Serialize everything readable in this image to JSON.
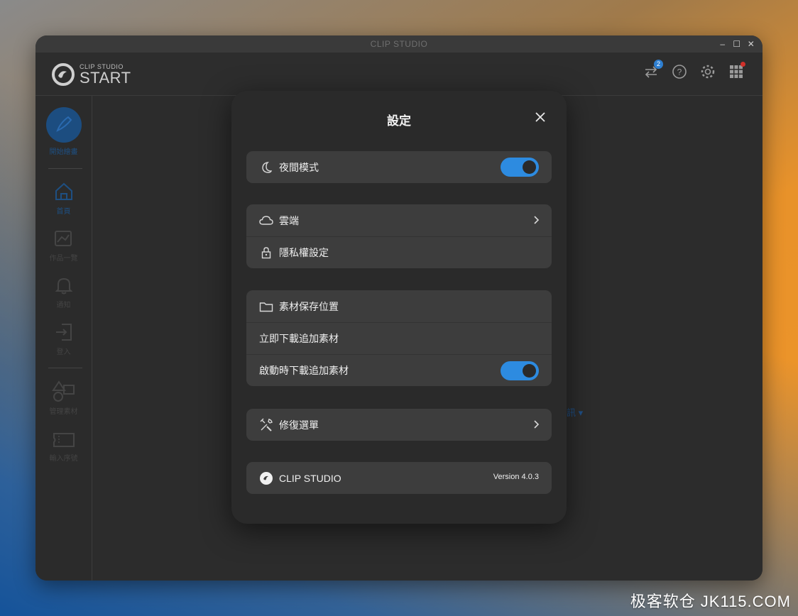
{
  "window": {
    "title": "CLIP STUDIO"
  },
  "header": {
    "logo_small": "CLIP STUDIO",
    "logo_big": "START",
    "sync_badge": "2"
  },
  "sidebar": {
    "items": [
      {
        "label": "開始繪畫",
        "icon": "brush-icon"
      },
      {
        "label": "首頁",
        "icon": "home-icon"
      },
      {
        "label": "作品一覽",
        "icon": "gallery-icon"
      },
      {
        "label": "通知",
        "icon": "bell-icon"
      },
      {
        "label": "登入",
        "icon": "login-icon"
      },
      {
        "label": "管理素材",
        "icon": "shapes-icon"
      },
      {
        "label": "輸入序號",
        "icon": "ticket-icon"
      }
    ]
  },
  "main": {
    "behind_link": "訊 ▾"
  },
  "settings": {
    "title": "設定",
    "night_mode": {
      "label": "夜間模式",
      "on": true
    },
    "cloud": {
      "label": "雲端"
    },
    "privacy": {
      "label": "隱私權設定"
    },
    "material_location": {
      "label": "素材保存位置"
    },
    "download_now": {
      "label": "立即下載追加素材"
    },
    "download_on_start": {
      "label": "啟動時下載追加素材",
      "on": true
    },
    "repair": {
      "label": "修復選單"
    },
    "about": {
      "label": "CLIP STUDIO",
      "version": "Version 4.0.3"
    }
  },
  "watermark": "极客软仓 JK115.COM",
  "colors": {
    "accent": "#2d8be0",
    "panel": "#3d3d3d",
    "modal": "#2a2a2a"
  }
}
